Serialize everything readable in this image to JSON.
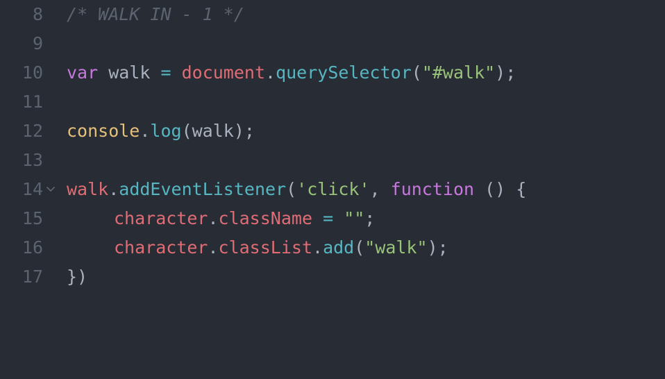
{
  "editor": {
    "language": "javascript",
    "theme_colors": {
      "background": "#282c34",
      "line_number": "#5c6370",
      "comment": "#5c6370",
      "keyword": "#c678dd",
      "variable": "#e06c75",
      "function": "#61afef",
      "string": "#98c379",
      "plain": "#abb2bf"
    },
    "lines": [
      {
        "number": "8",
        "tokens": [
          "/* WALK IN - 1 */"
        ]
      },
      {
        "number": "9",
        "tokens": []
      },
      {
        "number": "10",
        "tokens": [
          "var",
          " walk ",
          "=",
          " ",
          "document",
          ".",
          "querySelector",
          "(",
          "\"#walk\"",
          ");"
        ]
      },
      {
        "number": "11",
        "tokens": []
      },
      {
        "number": "12",
        "tokens": [
          "console",
          ".",
          "log",
          "(walk);"
        ]
      },
      {
        "number": "13",
        "tokens": []
      },
      {
        "number": "14",
        "fold_icon": "chevron-down-icon",
        "tokens": [
          "walk",
          ".",
          "addEventListener",
          "(",
          "'click'",
          ", ",
          "function",
          " () {"
        ]
      },
      {
        "number": "15",
        "tokens": [
          "character",
          ".",
          "className",
          " ",
          "=",
          " ",
          "\"\"",
          ";"
        ]
      },
      {
        "number": "16",
        "tokens": [
          "character",
          ".",
          "classList",
          ".",
          "add",
          "(",
          "\"walk\"",
          ");"
        ]
      },
      {
        "number": "17",
        "tokens": [
          "})"
        ]
      }
    ]
  }
}
